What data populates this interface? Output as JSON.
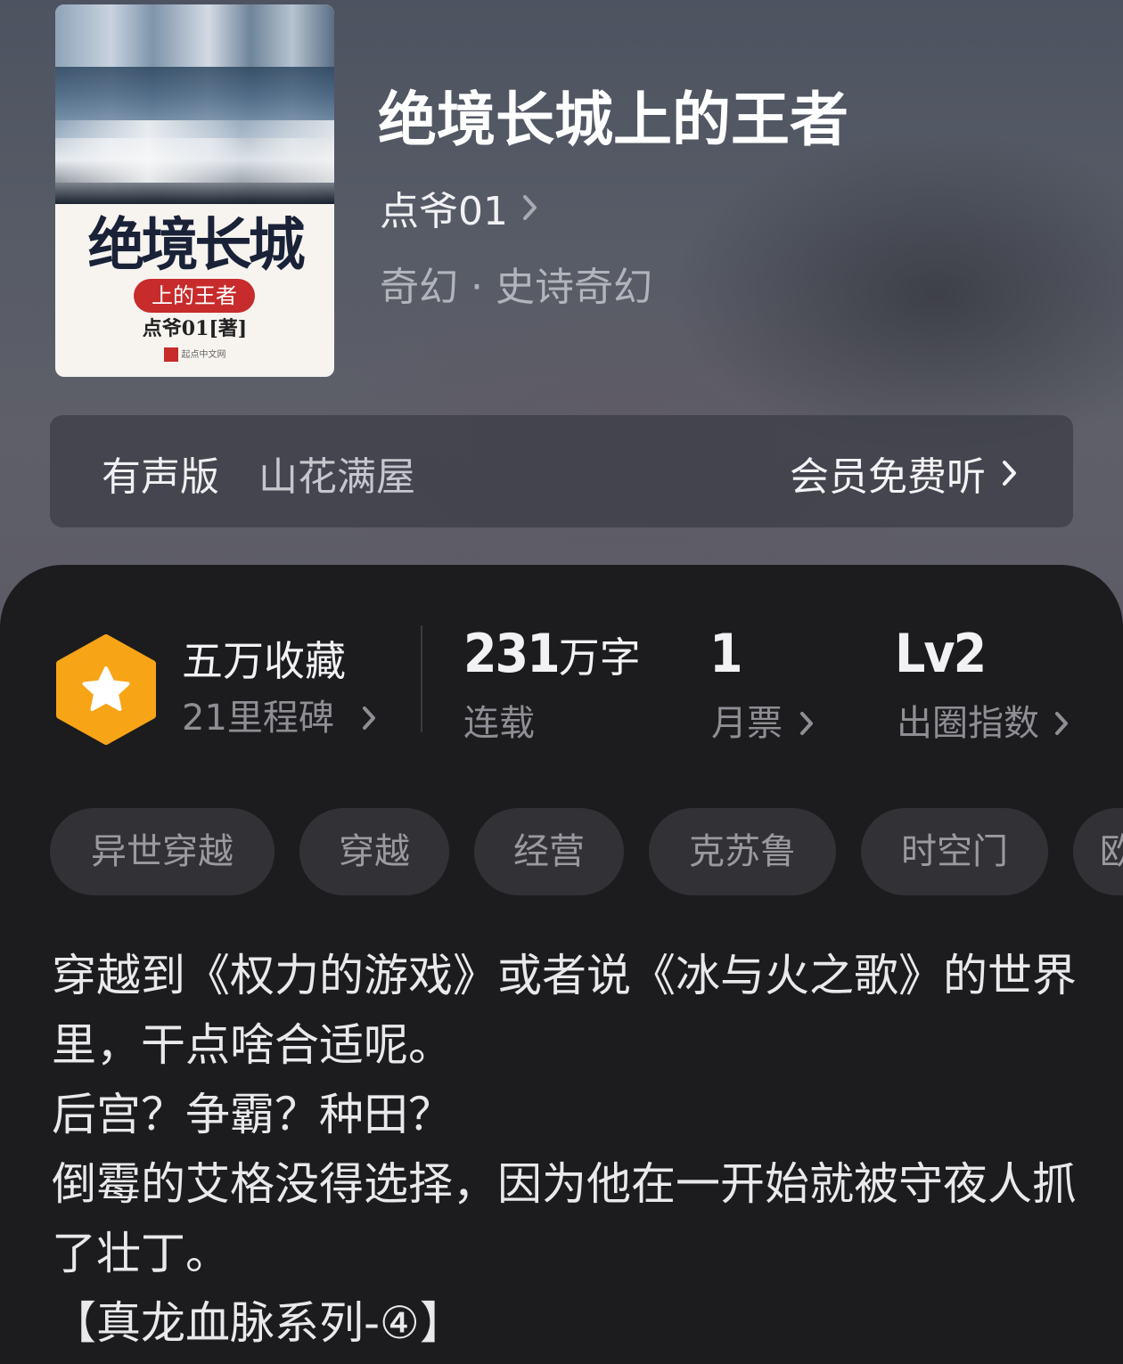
{
  "book": {
    "title": "绝境长城上的王者",
    "author": "点爷01",
    "genre": "奇幻 · 史诗奇幻",
    "cover": {
      "title": "绝境长城",
      "subtitle": "上的王者",
      "author": "点爷01[著]",
      "publisher": "起点中文网"
    }
  },
  "audio": {
    "label": "有声版",
    "narrator": "山花满屋",
    "action": "会员免费听"
  },
  "stats": {
    "collection": {
      "title": "五万收藏",
      "sub": "21里程碑"
    },
    "words": {
      "value": "231",
      "unit": "万字",
      "status": "连载"
    },
    "monthly_ticket": {
      "value": "1",
      "label": "月票"
    },
    "index": {
      "value": "Lv2",
      "label": "出圈指数"
    }
  },
  "tags": [
    "异世穿越",
    "穿越",
    "经营",
    "克苏鲁",
    "时空门",
    "欧"
  ],
  "description": [
    "穿越到《权力的游戏》或者说《冰与火之歌》的世界里，干点啥合适呢。",
    "后宫？争霸？种田？",
    "倒霉的艾格没得选择，因为他在一开始就被守夜人抓了壮丁。",
    "【真龙血脉系列-④】"
  ],
  "colors": {
    "badge_orange": "#f7a417",
    "card_bg": "#1c1c1e",
    "tag_bg": "#323236"
  }
}
